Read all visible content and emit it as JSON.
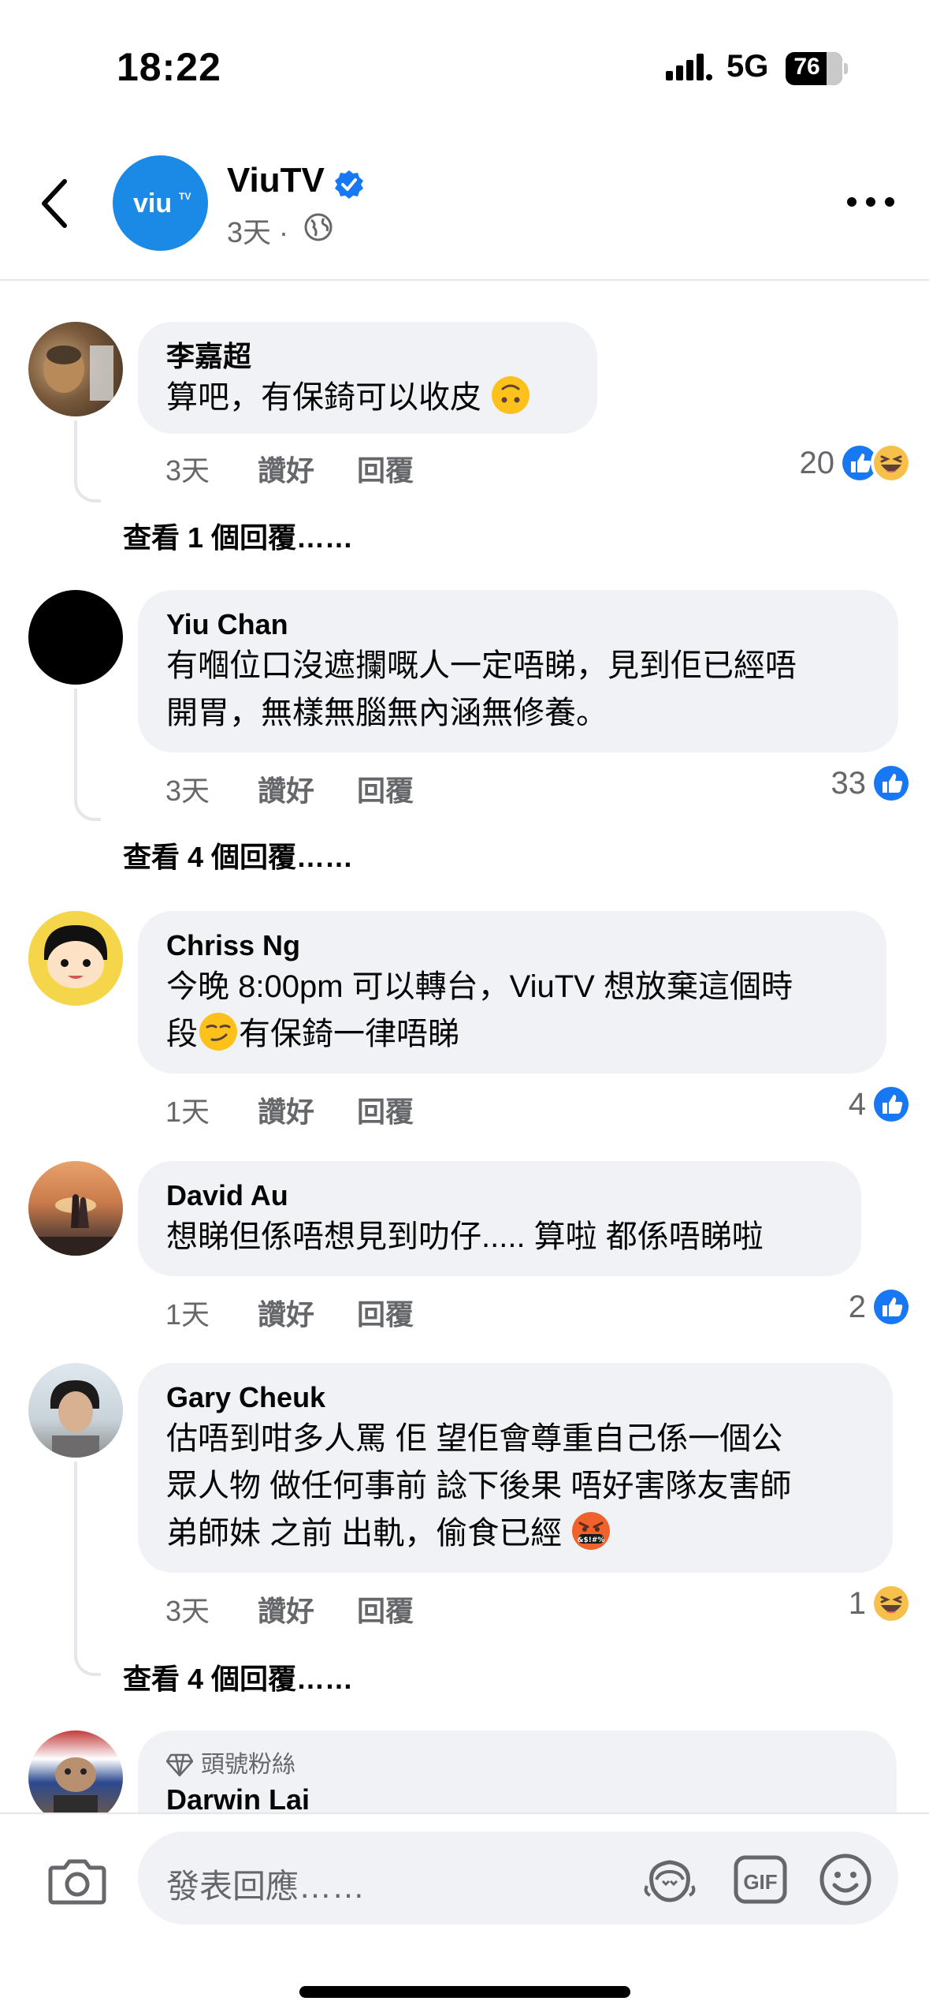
{
  "status_bar": {
    "time": "18:22",
    "network": "5G",
    "battery": "76"
  },
  "header": {
    "page_name": "ViuTV",
    "logo_text": "viu",
    "time": "3天 ·"
  },
  "comments": [
    {
      "author": "李嘉超",
      "text": "算吧，有保錡可以收皮",
      "time": "3天",
      "like": "讚好",
      "reply": "回覆",
      "reactions": "20",
      "view_replies": "查看 1 個回覆……"
    },
    {
      "author": "Yiu Chan",
      "text": "有嗰位口沒遮攔嘅人一定唔睇，見到佢已經唔\n開胃，無樣無腦無內涵無修養。",
      "time": "3天",
      "like": "讚好",
      "reply": "回覆",
      "reactions": "33",
      "view_replies": "查看 4 個回覆……"
    },
    {
      "author": "Chriss Ng",
      "text_a": "今晚 8:00pm 可以轉台，ViuTV 想放棄這個時",
      "text_b1": "段",
      "text_b2": "有保錡一律唔睇",
      "time": "1天",
      "like": "讚好",
      "reply": "回覆",
      "reactions": "4"
    },
    {
      "author": "David Au",
      "text": "想睇但係唔想見到叻仔..... 算啦 都係唔睇啦",
      "time": "1天",
      "like": "讚好",
      "reply": "回覆",
      "reactions": "2"
    },
    {
      "author": "Gary Cheuk",
      "text": "估唔到咁多人罵 佢 望佢會尊重自己係一個公\n眾人物 做任何事前 諗下後果 唔好害隊友害師\n弟師妹 之前 出軌，偷食已經",
      "time": "3天",
      "like": "讚好",
      "reply": "回覆",
      "reactions": "1",
      "view_replies": "查看 4 個回覆……"
    },
    {
      "badge": "頭號粉絲",
      "author": "Darwin Lai"
    }
  ],
  "composer": {
    "placeholder": "發表回應……",
    "gif_label": "GIF"
  },
  "colors": {
    "accent": "#1877f2",
    "bubble": "#f0f2f5",
    "secondary_text": "#65676b",
    "logo_blue": "#1a8ae6"
  },
  "icons": [
    "back-arrow-icon",
    "verified-icon",
    "globe-icon",
    "more-icon",
    "like-icon",
    "haha-icon",
    "camera-icon",
    "avatar-sticker-icon",
    "gif-icon",
    "emoji-icon",
    "diamond-icon"
  ]
}
